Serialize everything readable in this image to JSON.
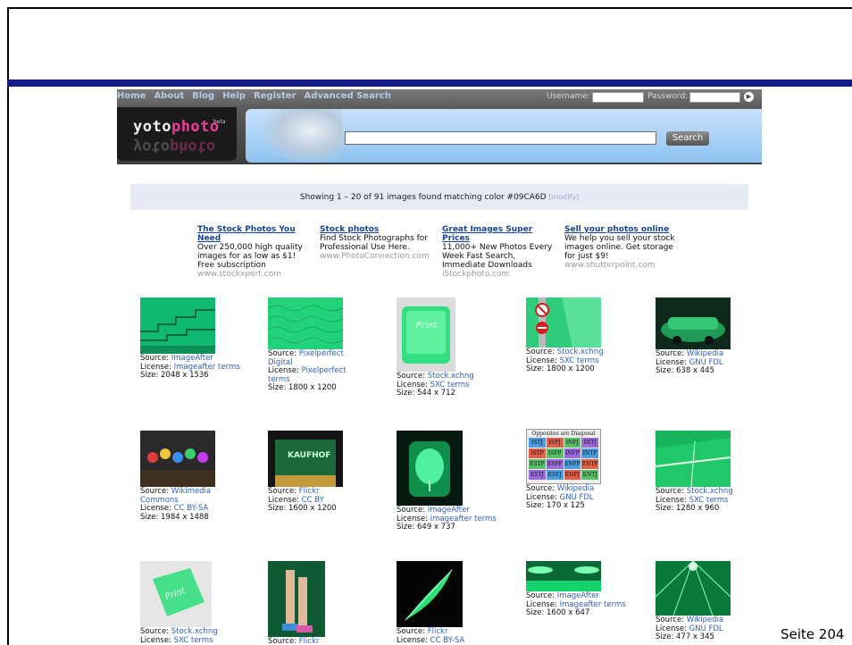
{
  "slide": {
    "page_label": "Seite 204"
  },
  "site": {
    "nav": [
      "Home",
      "About",
      "Blog",
      "Help",
      "Register",
      "Advanced Search"
    ],
    "login": {
      "username_label": "Username:",
      "password_label": "Password:"
    },
    "logo": {
      "part1": "yoto",
      "part2": "photo",
      "beta": "beta"
    },
    "search": {
      "button_label": "Search",
      "value": ""
    },
    "results_info": {
      "text": "Showing 1 – 20 of 91 images found matching color #09CA6D",
      "modify_label": "[modify]"
    },
    "ads": [
      {
        "title": "The Stock Photos You Need",
        "body": "Over 250,000 high quality images for as low as $1! Free subscription",
        "url": "www.stockxpert.com"
      },
      {
        "title": "Stock photos",
        "body": "Find Stock Photographs for Professional Use Here.",
        "url": "www.PhotoConnection.com"
      },
      {
        "title": "Great Images Super Prices",
        "body": "11,000+ New Photos Every Week Fast Search, Immediate Downloads",
        "url": "iStockphoto.com"
      },
      {
        "title": "Sell your photos online",
        "body": "We help you sell your stock images online. Get storage for just $9!",
        "url": "www.shutterpoint.com"
      }
    ],
    "labels": {
      "source": "Source:",
      "license": "License:",
      "size": "Size:"
    },
    "results": [
      {
        "source": "ImageAfter",
        "license": "Imageafter terms",
        "size": "2048 x 1536",
        "thumb_color": "#11b870"
      },
      {
        "source": "Pixelperfect Digital",
        "license": "Pixelperfect terms",
        "size": "1800 x 1200",
        "thumb_color": "#22d27a"
      },
      {
        "source": "Stock.xchng",
        "license": "SXC terms",
        "size": "544 x 712",
        "thumb_color": "#33e07f",
        "thumb_text": "Print"
      },
      {
        "source": "Stock.xchng",
        "license": "SXC terms",
        "size": "1800 x 1200",
        "thumb_color": "#2fcc7c"
      },
      {
        "source": "Wikipedia",
        "license": "GNU FDL",
        "size": "638 x 445",
        "thumb_color": "#1f9a57"
      },
      {
        "source": "Wikimedia Commons",
        "license": "CC BY-SA",
        "size": "1984 x 1488",
        "thumb_color": "#2a2a2a"
      },
      {
        "source": "Flickr",
        "license": "CC BY",
        "size": "1600 x 1200",
        "thumb_color": "#1c6a3c",
        "thumb_text": "KAUFHOF"
      },
      {
        "source": "ImageAfter",
        "license": "Imageafter terms",
        "size": "649 x 737",
        "thumb_color": "#0f8f4c"
      },
      {
        "source": "Wikipedia",
        "license": "GNU FDL",
        "size": "170 x 125",
        "thumb_color": "#cccccc",
        "thumb_text": "Opposites are Diagonal",
        "mbti": [
          "ISTJ",
          "ISFJ",
          "INFJ",
          "INTJ",
          "ISTP",
          "ISFP",
          "INFP",
          "INTP",
          "ESTP",
          "ESFP",
          "ENFP",
          "ENTP",
          "ESTJ",
          "ESFJ",
          "ENFJ",
          "ENTJ"
        ]
      },
      {
        "source": "Stock.xchng",
        "license": "SXC terms",
        "size": "1280 x 960",
        "thumb_color": "#17b65c"
      },
      {
        "source": "Stock.xchng",
        "license": "SXC terms",
        "size": "",
        "thumb_color": "#46e08a",
        "thumb_text": "Print"
      },
      {
        "source": "Flickr",
        "license": "",
        "size": "",
        "thumb_color": "#0e5a33"
      },
      {
        "source": "Flickr",
        "license": "CC BY-SA",
        "size": "",
        "thumb_color": "#0a0a0a"
      },
      {
        "source": "ImageAfter",
        "license": "Imageafter terms",
        "size": "1600 x 647",
        "thumb_color": "#14d46c"
      },
      {
        "source": "Wikipedia",
        "license": "GNU FDL",
        "size": "477 x 345",
        "thumb_color": "#0a7a3a"
      }
    ]
  }
}
